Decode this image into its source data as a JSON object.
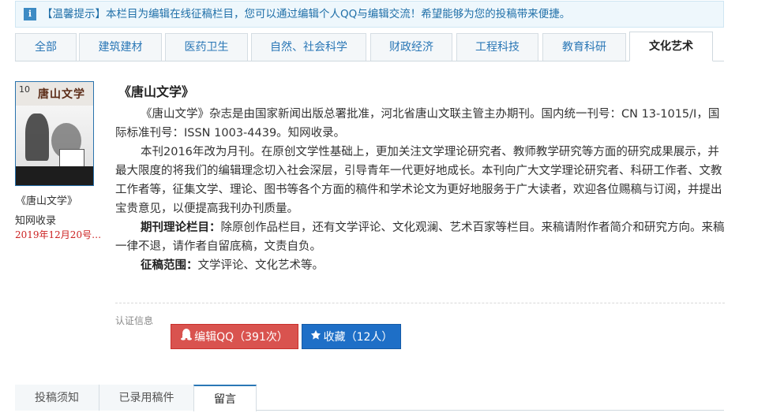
{
  "notice": {
    "icon": "info-icon",
    "text": "【温馨提示】本栏目为编辑在线征稿栏目，您可以通过编辑个人QQ与编辑交流！希望能够为您的投稿带来便捷。"
  },
  "tabs": [
    {
      "label": "全部"
    },
    {
      "label": "建筑建材"
    },
    {
      "label": "医药卫生"
    },
    {
      "label": "自然、社会科学"
    },
    {
      "label": "财政经济"
    },
    {
      "label": "工程科技"
    },
    {
      "label": "教育科研"
    },
    {
      "label": "文化艺术",
      "active": true
    }
  ],
  "cover": {
    "issue_number": "10",
    "title_art": "唐山文学"
  },
  "sidebar": {
    "title": "《唐山文学》",
    "database": "知网收录",
    "date": "2019年12月20号…"
  },
  "magazine": {
    "title": "《唐山文学》",
    "para1": "《唐山文学》杂志是由国家新闻出版总署批准，河北省唐山文联主管主办期刊。国内统一刊号：CN 13-1015/I，国际标准刊号：ISSN 1003-4439。知网收录。",
    "para2": "本刊2016年改为月刊。在原创文学性基础上，更加关注文学理论研究者、教师教学研究等方面的研究成果展示，并最大限度的将我们的编辑理念切入社会深层，引导青年一代更好地成长。本刊向广大文学理论研究者、科研工作者、文教工作者等，征集文学、理论、图书等各个方面的稿件和学术论文为更好地服务于广大读者，欢迎各位赐稿与订阅，并提出宝贵意见，以便提高我刊办刊质量。",
    "para3_label": "期刊理论栏目：",
    "para3_text": "除原创作品栏目，还有文学评论、文化观澜、艺术百家等栏目。来稿请附作者简介和研究方向。来稿一律不退，请作者自留底稿，文责自负。",
    "para4_label": "征稿范围：",
    "para4_text": "文学评论、文化艺术等。"
  },
  "cert": {
    "label": "认证信息"
  },
  "actions": {
    "qq_label": "编辑QQ（391次）",
    "qq_icon": "qq-penguin-icon",
    "fav_label": "收藏（12人）",
    "fav_icon": "star-icon",
    "colors": {
      "qq": "#d9534f",
      "fav": "#1e6fc7"
    }
  },
  "bottom_tabs": [
    {
      "label": "投稿须知"
    },
    {
      "label": "已录用稿件"
    },
    {
      "label": "留言",
      "active": true
    }
  ]
}
